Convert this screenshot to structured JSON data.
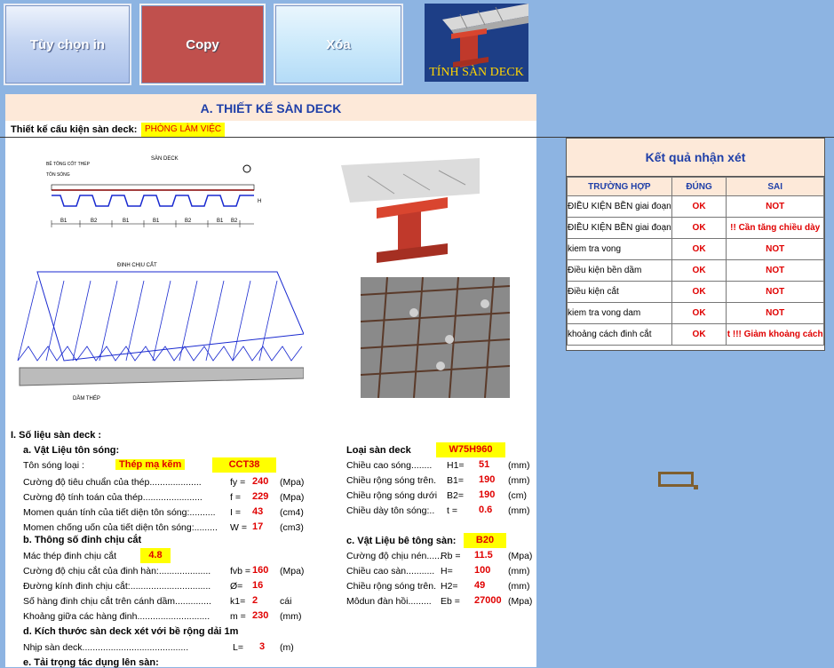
{
  "toolbar": {
    "print_label": "Tùy chọn in",
    "copy_label": "Copy",
    "delete_label": "Xóa"
  },
  "logo": {
    "text": "TÍNH SÀN DECK"
  },
  "sheet": {
    "title": "A. THIẾT KẾ SÀN DECK",
    "design_label": "Thiết kế cấu kiện sàn deck:",
    "design_value": "PHÒNG LÀM VIỆC",
    "drawing_labels": {
      "san_deck": "SÀN DECK",
      "be_tong": "BÊ TÔNG CỐT THÉP",
      "ton_song": "TÔN SÓNG",
      "b1": "B1",
      "b2": "B2",
      "h": "H",
      "h1": "H1",
      "h2": "H2",
      "a": "a",
      "dinh_chiu_cat": "ĐINH CHỊU CẮT",
      "dam_thep": "DẦM THÉP"
    },
    "section1": "I.  Số liệu sàn deck :",
    "sec_a": "a. Vật Liệu tôn sóng:",
    "ton_song_loai": "Tôn sóng loại :",
    "ton_song_type": "Thép mạ kẽm",
    "ton_song_grade": "CCT38",
    "rows_a": [
      {
        "label": "Cường độ tiêu chuẩn của thép....................",
        "sym": "fy =",
        "val": "240",
        "unit": "(Mpa)"
      },
      {
        "label": "Cường độ tính toán của thép.......................",
        "sym": "f =",
        "val": "229",
        "unit": "(Mpa)"
      },
      {
        "label": "Momen quán tính của tiết diện tôn sóng:..........",
        "sym": "I =",
        "val": "43",
        "unit": "(cm4)"
      },
      {
        "label": "Momen chống uốn của tiết diện tôn sóng:.........",
        "sym": "W =",
        "val": "17",
        "unit": "(cm3)"
      }
    ],
    "sec_b": "b. Thông số đinh chịu cắt",
    "mac_thep": "Mác thép đinh chịu cắt",
    "mac_thep_val": "4.8",
    "rows_b": [
      {
        "label": "Cường độ chịu cắt của  đinh hàn:....................",
        "sym": "fvb =",
        "val": "160",
        "unit": "(Mpa)"
      },
      {
        "label": "Đường kính đinh chịu cắt:...............................",
        "sym": "Ø=",
        "val": "16",
        "unit": ""
      },
      {
        "label": "Số hàng đinh chịu cắt trên cánh dầm..............",
        "sym": "k1=",
        "val": "2",
        "unit": "cái"
      },
      {
        "label": "Khoảng giữa các hàng đinh............................",
        "sym": "m =",
        "val": "230",
        "unit": "(mm)"
      }
    ],
    "sec_d": "d. Kích thước sàn deck xét với bề rộng dải 1m",
    "nhip_label": "Nhịp sàn deck.........................................",
    "nhip_sym": "L=",
    "nhip_val": "3",
    "nhip_unit": "(m)",
    "sec_e": "e. Tải trọng tác dụng lên sàn:",
    "loai_san_label": "Loại sàn deck",
    "loai_san_val": "W75H960",
    "rows_right1": [
      {
        "label": "Chiều cao sóng........",
        "sym": "H1=",
        "val": "51",
        "unit": "(mm)"
      },
      {
        "label": "Chiều rộng sóng trên.",
        "sym": "B1=",
        "val": "190",
        "unit": "(mm)"
      },
      {
        "label": "Chiều rộng sóng dưới",
        "sym": "B2=",
        "val": "190",
        "unit": "(cm)"
      },
      {
        "label": "Chiều dày tôn sóng:..",
        "sym": "t =",
        "val": "0.6",
        "unit": "(mm)"
      }
    ],
    "sec_c": "c. Vật Liệu bê tông sàn:",
    "concrete_grade": "B20",
    "rows_right2": [
      {
        "label": "Cường độ chịu nén......",
        "sym": "Rb =",
        "val": "11.5",
        "unit": "(Mpa)"
      },
      {
        "label": "Chiều cao sàn...........",
        "sym": "H=",
        "val": "100",
        "unit": "(mm)"
      },
      {
        "label": "Chiều rộng sóng trên.",
        "sym": "H2=",
        "val": "49",
        "unit": "(mm)"
      },
      {
        "label": "Môdun đàn hồi.........",
        "sym": "Eb =",
        "val": "27000",
        "unit": "(Mpa)"
      }
    ]
  },
  "result": {
    "title": "Kết quả nhận xét",
    "headers": [
      "TRƯỜNG HỢP",
      "ĐÚNG",
      "SAI"
    ],
    "rows": [
      {
        "case": "ĐIỀU KIỆN BỀN giai đoạn",
        "ok": "OK",
        "sai": "NOT"
      },
      {
        "case": "ĐIỀU KIỆN BỀN giai đoạn",
        "ok": "OK",
        "sai": "!! Cần tăng chiều dày"
      },
      {
        "case": "kiem tra vong",
        "ok": "OK",
        "sai": "NOT"
      },
      {
        "case": "Điều kiện bền dầm",
        "ok": "OK",
        "sai": "NOT"
      },
      {
        "case": "Điều kiện cắt",
        "ok": "OK",
        "sai": "NOT"
      },
      {
        "case": "kiem tra vong dam",
        "ok": "OK",
        "sai": "NOT"
      },
      {
        "case": "khoảng cách đinh cắt",
        "ok": "OK",
        "sai": "t !!! Giảm khoảng cách"
      }
    ]
  }
}
